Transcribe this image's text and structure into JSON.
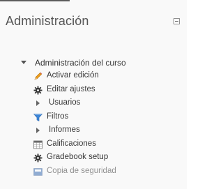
{
  "block": {
    "title": "Administración",
    "collapse_icon": "minus-box-icon"
  },
  "tree": {
    "root_label": "Administración del curso",
    "items": [
      {
        "label": "Activar edición",
        "icon": "pencil-icon"
      },
      {
        "label": "Editar ajustes",
        "icon": "gear-icon"
      },
      {
        "label": "Usuarios",
        "icon": "caret-right-icon"
      },
      {
        "label": "Filtros",
        "icon": "filter-funnel-icon"
      },
      {
        "label": "Informes",
        "icon": "caret-right-icon"
      },
      {
        "label": "Calificaciones",
        "icon": "gradebook-table-icon"
      },
      {
        "label": "Gradebook setup",
        "icon": "gear-icon"
      },
      {
        "label": "Copia de seguridad",
        "icon": "backup-icon"
      }
    ]
  }
}
